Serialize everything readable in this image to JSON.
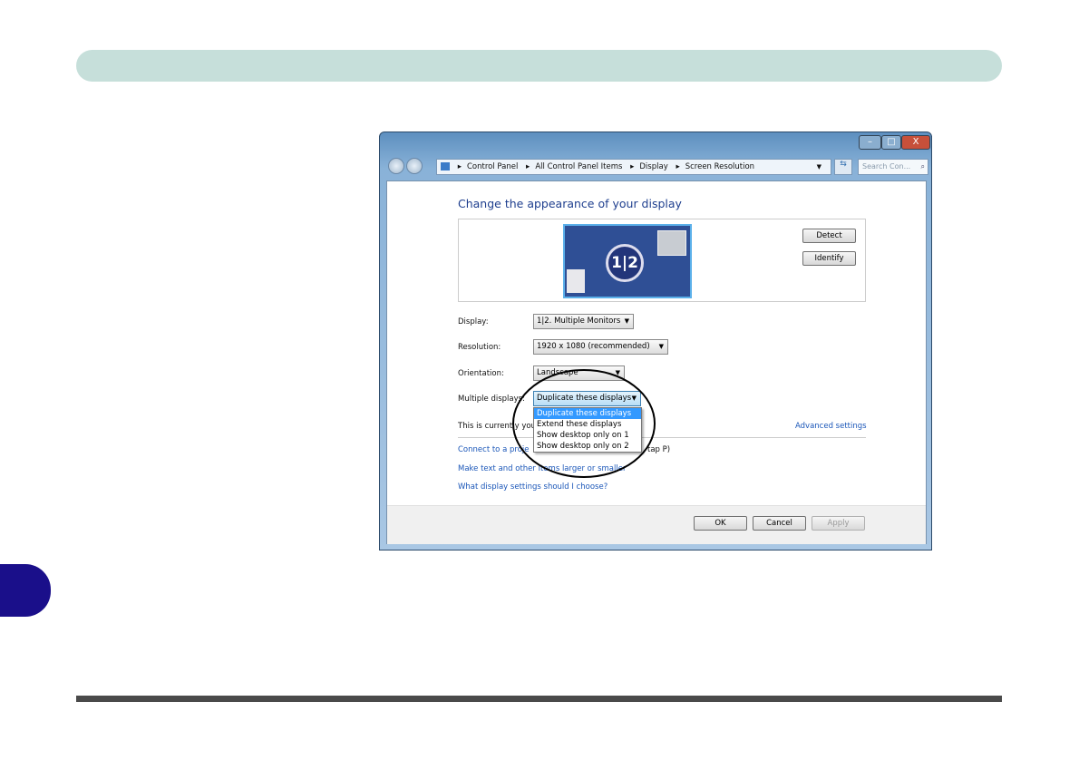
{
  "colors": {
    "header_bar": "#c6dfda",
    "chapter_tab": "#1a0f8a",
    "link": "#1a56b8",
    "title": "#1e3e8e",
    "selected": "#3399ff"
  },
  "window": {
    "controls": {
      "minimize": "–",
      "maximize": "□",
      "close": "X"
    },
    "breadcrumb": [
      "Control Panel",
      "All Control Panel Items",
      "Display",
      "Screen Resolution"
    ],
    "search_placeholder": "Search Con...",
    "heading": "Change the appearance of your display",
    "monitor_label": "1|2",
    "detect": "Detect",
    "identify": "Identify",
    "display_label": "Display:",
    "display_value": "1|2. Multiple Monitors",
    "resolution_label": "Resolution:",
    "resolution_value": "1920 x 1080 (recommended)",
    "orientation_label": "Orientation:",
    "orientation_value": "Landscape",
    "multiple_label": "Multiple displays:",
    "multiple_value": "Duplicate these displays",
    "multiple_options": [
      "Duplicate these displays",
      "Extend these displays",
      "Show desktop only on 1",
      "Show desktop only on 2"
    ],
    "current_text": "This is currently you",
    "advanced": "Advanced settings",
    "connect_text": "Connect to a proje",
    "connect_tail": "tap P)",
    "larger_link": "Make text and other items larger or smaller",
    "which_link": "What display settings should I choose?",
    "ok": "OK",
    "cancel": "Cancel",
    "apply": "Apply"
  }
}
